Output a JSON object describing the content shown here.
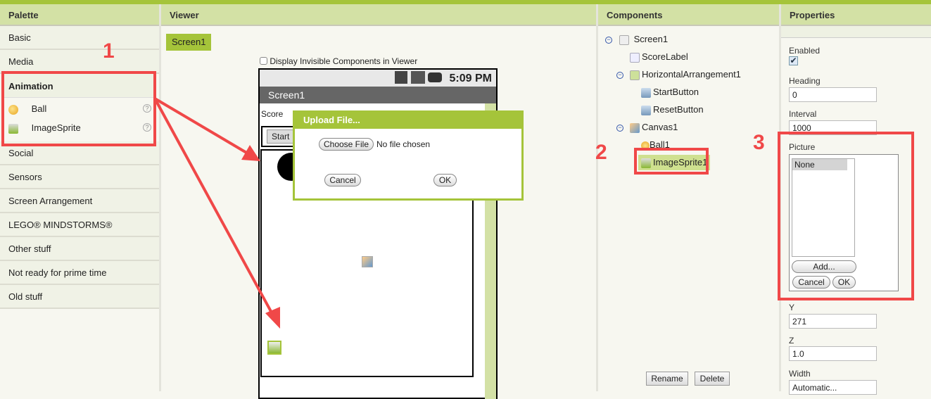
{
  "headers": {
    "palette": "Palette",
    "viewer": "Viewer",
    "components": "Components",
    "properties": "Properties"
  },
  "palette": {
    "categories": [
      "Basic",
      "Media",
      "Animation",
      "Social",
      "Sensors",
      "Screen Arrangement",
      "LEGO® MINDSTORMS®",
      "Other stuff",
      "Not ready for prime time",
      "Old stuff"
    ],
    "animation_items": [
      {
        "label": "Ball",
        "icon": "ball-icon"
      },
      {
        "label": "ImageSprite",
        "icon": "image-sprite-icon"
      }
    ],
    "help": "?"
  },
  "viewer": {
    "screen_tab": "Screen1",
    "display_invisible": "Display Invisible Components in Viewer",
    "time": "5:09 PM",
    "title": "Screen1",
    "score": "Score",
    "start": "Start"
  },
  "dialog": {
    "title": "Upload File...",
    "choose": "Choose File",
    "no_file": "No file chosen",
    "cancel": "Cancel",
    "ok": "OK"
  },
  "components": {
    "tree": [
      {
        "label": "Screen1",
        "icon": "screen-icon"
      },
      {
        "label": "ScoreLabel",
        "icon": "label-icon"
      },
      {
        "label": "HorizontalArrangement1",
        "icon": "arrangement-icon"
      },
      {
        "label": "StartButton",
        "icon": "button-icon"
      },
      {
        "label": "ResetButton",
        "icon": "button-icon"
      },
      {
        "label": "Canvas1",
        "icon": "canvas-icon"
      },
      {
        "label": "Ball1",
        "icon": "ball-icon"
      },
      {
        "label": "ImageSprite1",
        "icon": "image-sprite-icon",
        "selected": true
      }
    ],
    "rename": "Rename",
    "delete": "Delete"
  },
  "properties": {
    "enabled_label": "Enabled",
    "enabled": true,
    "heading_label": "Heading",
    "heading": "0",
    "interval_label": "Interval",
    "interval": "1000",
    "picture_label": "Picture",
    "picture_options": [
      "None"
    ],
    "add": "Add...",
    "cancel": "Cancel",
    "ok": "OK",
    "y_label": "Y",
    "y": "271",
    "z_label": "Z",
    "z": "1.0",
    "width_label": "Width",
    "width": "Automatic..."
  },
  "annotations": [
    "1",
    "2",
    "3"
  ],
  "colors": {
    "accent": "#a5c43a",
    "header": "#d3e1a5",
    "annotation": "#f04848"
  }
}
